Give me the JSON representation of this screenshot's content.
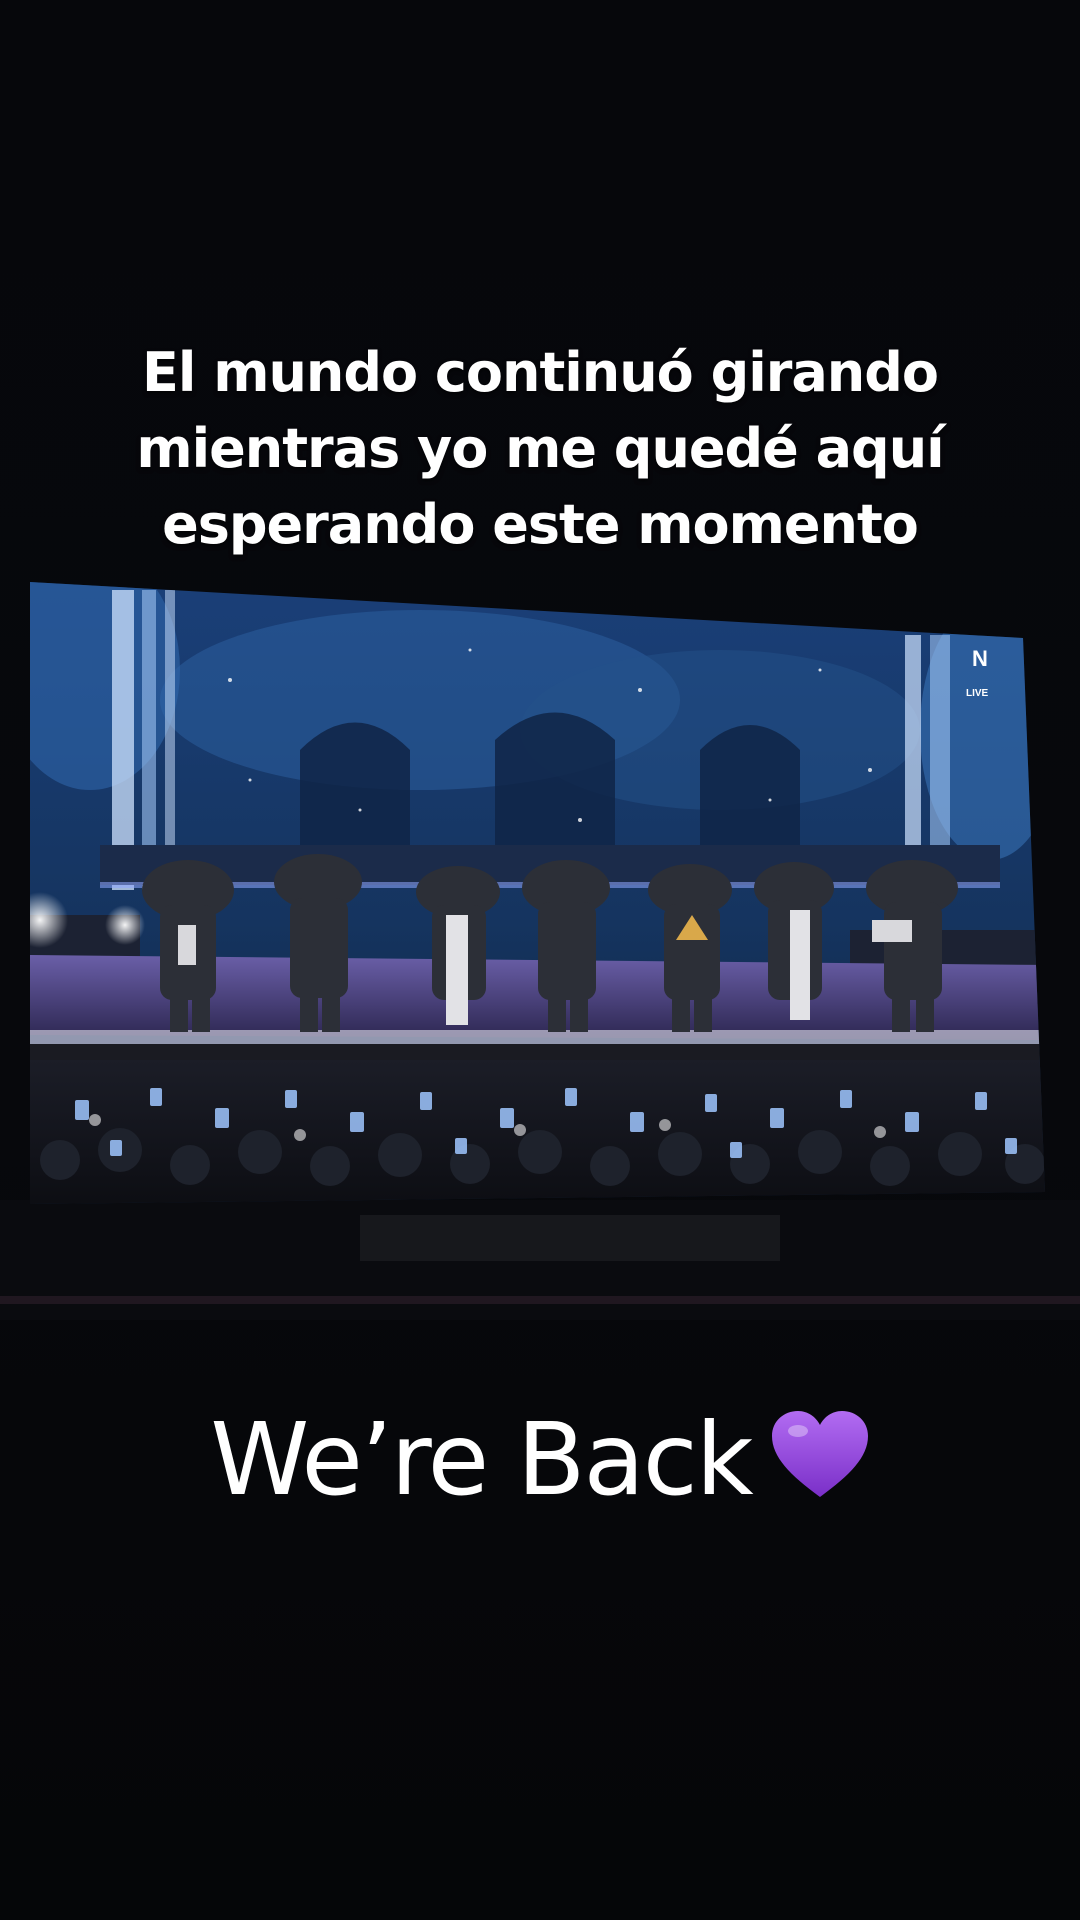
{
  "caption": {
    "lines": [
      "El mundo continuó girando",
      "mientras yo me quedé aquí",
      "esperando este momento"
    ],
    "footer_text": "We’re Back",
    "footer_emoji": "purple-heart-icon"
  },
  "screen": {
    "broadcast_logo": "N",
    "broadcast_tag": "LIVE"
  },
  "colors": {
    "background": "#06070a",
    "text": "#ffffff",
    "heart": "#8a3dd6",
    "stage_blue": "#1f4f8c"
  }
}
